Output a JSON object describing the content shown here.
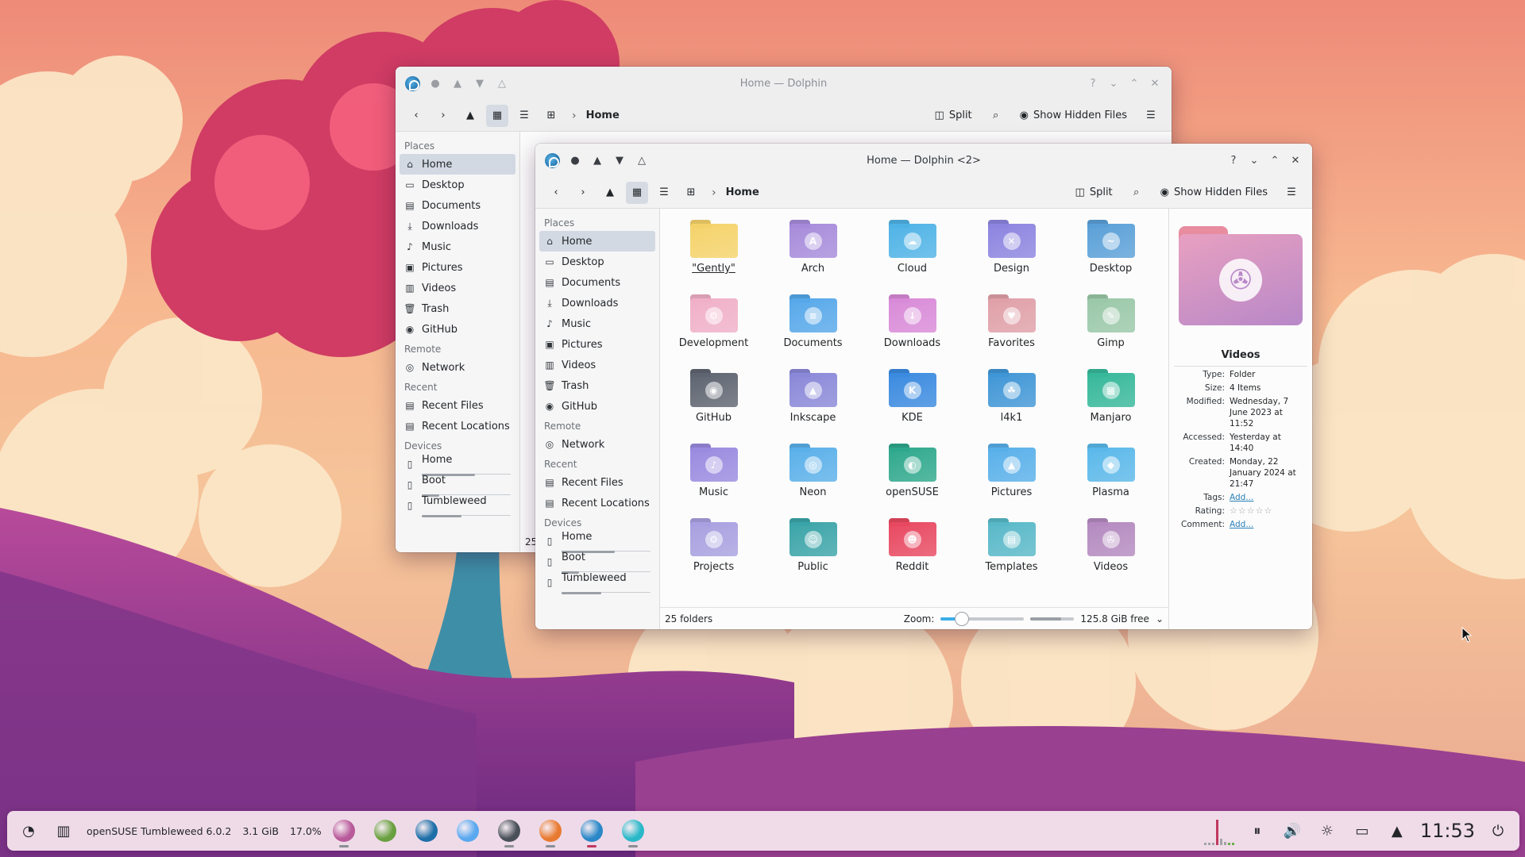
{
  "back_window": {
    "title": "Home — Dolphin",
    "breadcrumb": "Home",
    "split_label": "Split",
    "hidden_label": "Show Hidden Files",
    "status_partial": "25",
    "places_header": "Places",
    "places": [
      "Home",
      "Desktop",
      "Documents",
      "Downloads",
      "Music",
      "Pictures",
      "Videos",
      "Trash",
      "GitHub"
    ],
    "remote_header": "Remote",
    "remote": [
      "Network"
    ],
    "recent_header": "Recent",
    "recent": [
      "Recent Files",
      "Recent Locations"
    ],
    "devices_header": "Devices",
    "devices": [
      "Home",
      "Boot",
      "Tumbleweed"
    ]
  },
  "front_window": {
    "title": "Home — Dolphin <2>",
    "breadcrumb": "Home",
    "split_label": "Split",
    "hidden_label": "Show Hidden Files",
    "places_header": "Places",
    "places": [
      "Home",
      "Desktop",
      "Documents",
      "Downloads",
      "Music",
      "Pictures",
      "Videos",
      "Trash",
      "GitHub"
    ],
    "remote_header": "Remote",
    "remote": [
      "Network"
    ],
    "recent_header": "Recent",
    "recent": [
      "Recent Files",
      "Recent Locations"
    ],
    "devices_header": "Devices",
    "devices": [
      "Home",
      "Boot",
      "Tumbleweed"
    ],
    "files": [
      {
        "name": "\"Gently\"",
        "color": "#f5d36a",
        "emb": ""
      },
      {
        "name": "Arch",
        "color": "#a78bdb",
        "emb": "A"
      },
      {
        "name": "Cloud",
        "color": "#4fb3e6",
        "emb": "☁"
      },
      {
        "name": "Design",
        "color": "#8c84e0",
        "emb": "✕"
      },
      {
        "name": "Desktop",
        "color": "#5aa0d8",
        "emb": "~"
      },
      {
        "name": "Development",
        "color": "#f0b0c8",
        "emb": "⚙"
      },
      {
        "name": "Documents",
        "color": "#56a8ea",
        "emb": "≡"
      },
      {
        "name": "Downloads",
        "color": "#d98ad8",
        "emb": "↓"
      },
      {
        "name": "Favorites",
        "color": "#e0a0a8",
        "emb": "♥"
      },
      {
        "name": "Gimp",
        "color": "#9ac8a8",
        "emb": "✎"
      },
      {
        "name": "GitHub",
        "color": "#5e6470",
        "emb": "◉"
      },
      {
        "name": "Inkscape",
        "color": "#8a88d8",
        "emb": "▲"
      },
      {
        "name": "KDE",
        "color": "#3a8ae0",
        "emb": "K"
      },
      {
        "name": "l4k1",
        "color": "#3f96d6",
        "emb": "☘"
      },
      {
        "name": "Manjaro",
        "color": "#36b89a",
        "emb": "▦"
      },
      {
        "name": "Music",
        "color": "#9a8ae0",
        "emb": "♪"
      },
      {
        "name": "Neon",
        "color": "#5ab0ea",
        "emb": "◎"
      },
      {
        "name": "openSUSE",
        "color": "#2ea88c",
        "emb": "◐"
      },
      {
        "name": "Pictures",
        "color": "#58b0ea",
        "emb": "▲"
      },
      {
        "name": "Plasma",
        "color": "#5ab8ea",
        "emb": "◆"
      },
      {
        "name": "Projects",
        "color": "#a8a0e0",
        "emb": "⚙"
      },
      {
        "name": "Public",
        "color": "#3aa4a8",
        "emb": "☺"
      },
      {
        "name": "Reddit",
        "color": "#e84860",
        "emb": "☻"
      },
      {
        "name": "Templates",
        "color": "#58b8c8",
        "emb": "▤"
      },
      {
        "name": "Videos",
        "color": "#b48ac0",
        "emb": "✇"
      }
    ],
    "status_count": "25 folders",
    "zoom_label": "Zoom:",
    "zoom_level": 0.25,
    "free_space": "125.8 GiB free",
    "free_used_fraction": 0.7,
    "info": {
      "name": "Videos",
      "rows": [
        {
          "key": "Type:",
          "val": "Folder"
        },
        {
          "key": "Size:",
          "val": "4 Items"
        },
        {
          "key": "Modified:",
          "val": "Wednesday, 7 June 2023 at 11:52"
        },
        {
          "key": "Accessed:",
          "val": "Yesterday at 14:40"
        },
        {
          "key": "Created:",
          "val": "Monday, 22 January 2024 at 21:47"
        }
      ],
      "tags_key": "Tags:",
      "tags_val": "Add...",
      "rating_key": "Rating:",
      "comment_key": "Comment:",
      "comment_val": "Add..."
    }
  },
  "taskbar": {
    "distro": "openSUSE Tumbleweed 6.0.2",
    "memory": "3.1 GiB",
    "cpu": "17.0%",
    "clock": "11:53",
    "apps": [
      {
        "name": "app-1-icon",
        "color": "#b85a9a"
      },
      {
        "name": "app-2-icon",
        "color": "#6aa040"
      },
      {
        "name": "app-3-icon",
        "color": "#1e6fa8"
      },
      {
        "name": "app-4-icon",
        "color": "#5aa8f0"
      },
      {
        "name": "app-5-icon",
        "color": "#4a5058"
      },
      {
        "name": "firefox-icon",
        "color": "#e87a30"
      },
      {
        "name": "dolphin-icon",
        "color": "#2a88c8"
      },
      {
        "name": "app-8-icon",
        "color": "#2ab8c8"
      }
    ]
  }
}
